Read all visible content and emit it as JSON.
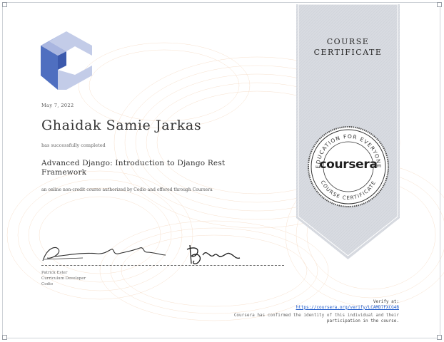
{
  "certificate": {
    "date": "May 7, 2022",
    "recipient_name": "Ghaidak Samie Jarkas",
    "completed_text": "has successfully completed",
    "course_title": "Advanced Django: Introduction to Django Rest Framework",
    "authorized_text": "an online non-credit course authorized by Codio and offered through Coursera"
  },
  "signer": {
    "name": "Patrick Ester",
    "title": "Curriculum Developer",
    "organization": "Codio"
  },
  "ribbon": {
    "line1": "COURSE",
    "line2": "CERTIFICATE"
  },
  "seal": {
    "brand": "coursera",
    "ring_top": "EDUCATION FOR EVERYONE",
    "ring_bottom": "COURSE CERTIFICATE"
  },
  "verify": {
    "label": "Verify at:",
    "url": "https://coursera.org/verify/LCAMD7FXCG4B",
    "note_line1": "Coursera has confirmed the identity of this individual and their",
    "note_line2": "participation in the course."
  },
  "colors": {
    "logo_light": "#c3cce8",
    "logo_dark": "#4f6fc0",
    "ribbon": "#d8dbe1",
    "link": "#1a56c8",
    "guilloche": "#f3d3b8"
  },
  "icons": [
    "codio-logo-icon",
    "coursera-seal-icon"
  ]
}
